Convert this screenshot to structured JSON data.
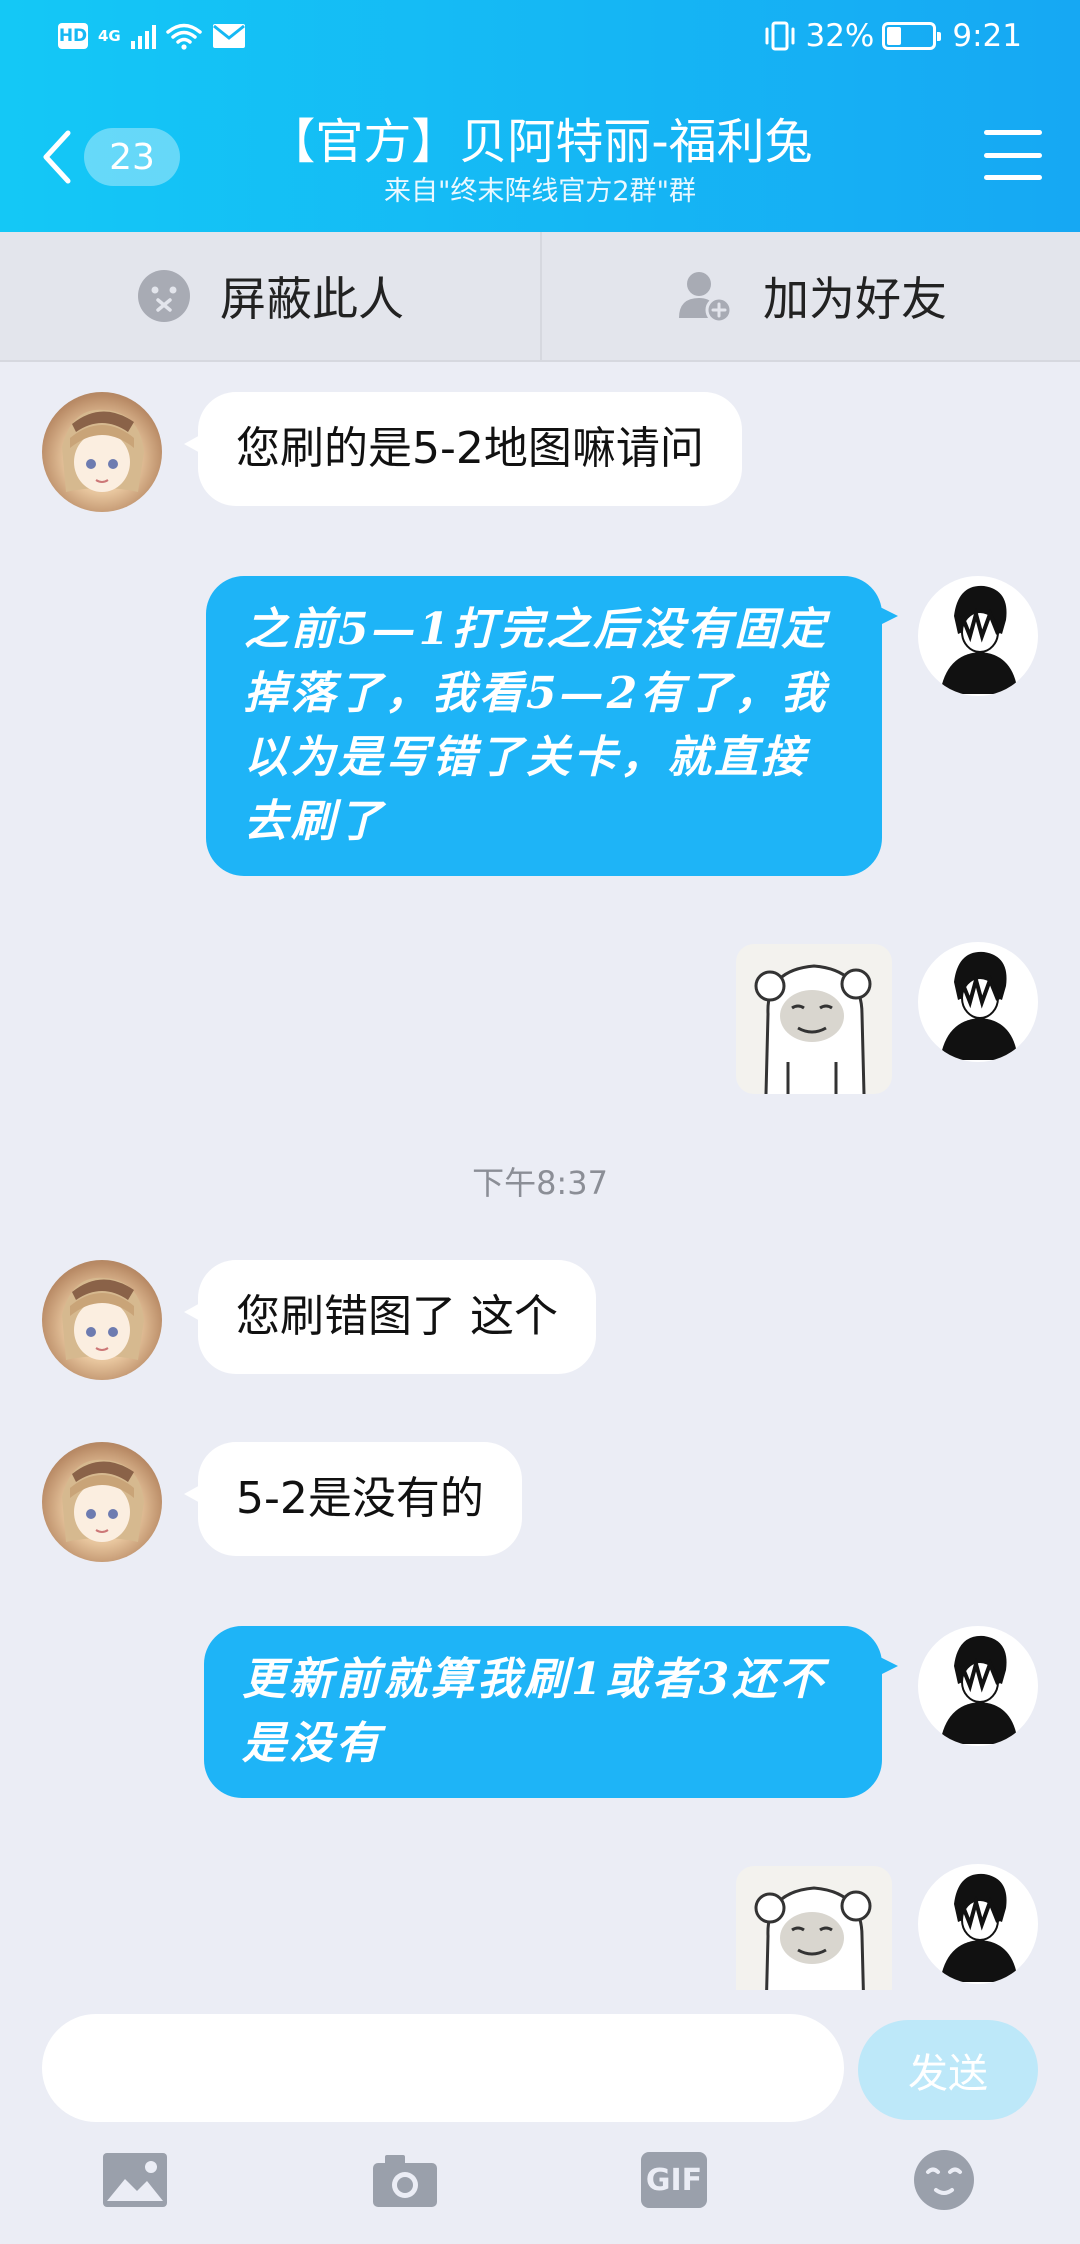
{
  "status_bar": {
    "hd": "HD",
    "network": "4G",
    "battery": "32%",
    "battery_level": 0.32,
    "time": "9:21"
  },
  "header": {
    "back_count": "23",
    "title": "【官方】贝阿特丽-福利兔",
    "subtitle": "来自\"终末阵线官方2群\"群"
  },
  "actions": {
    "block": "屏蔽此人",
    "add_friend": "加为好友"
  },
  "messages": [
    {
      "from": "them",
      "type": "text",
      "text": "您刷的是5-2地图嘛请问"
    },
    {
      "from": "me",
      "type": "text",
      "lines": [
        "之前5—1打完之后没有固定",
        "掉落了，我看5—2有了，我",
        "以为是写错了关卡，就直接",
        "去刷了"
      ]
    },
    {
      "from": "me",
      "type": "sticker",
      "sticker": "panda-face-sticker"
    },
    {
      "type": "timestamp",
      "text": "下午8:37"
    },
    {
      "from": "them",
      "type": "text",
      "text": "您刷错图了 这个"
    },
    {
      "from": "them",
      "type": "text",
      "text": "5-2是没有的"
    },
    {
      "from": "me",
      "type": "text",
      "lines": [
        "更新前就算我刷1或者3还不",
        "是没有"
      ]
    },
    {
      "from": "me",
      "type": "sticker",
      "sticker": "panda-face-sticker"
    }
  ],
  "input": {
    "value": "",
    "placeholder": "",
    "send_label": "发送"
  },
  "toolbar": {
    "gif_label": "GIF",
    "icons": [
      "image-icon",
      "camera-icon",
      "gif-icon",
      "emoji-icon"
    ]
  },
  "colors": {
    "header_start": "#14c8f6",
    "header_end": "#16a8f3",
    "out_bubble": "#1eb4f7",
    "background": "#ebedf5"
  }
}
